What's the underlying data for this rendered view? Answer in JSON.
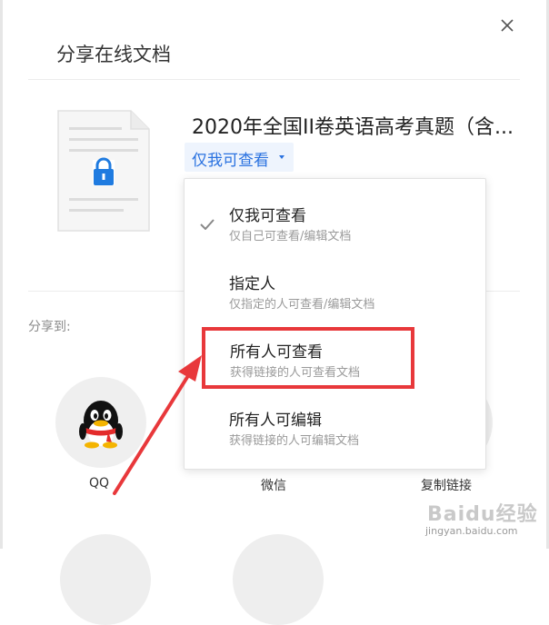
{
  "dialog": {
    "title": "分享在线文档",
    "close_icon": "close-icon"
  },
  "document": {
    "name": "2020年全国II卷英语高考真题（含...",
    "icon": "locked-document-icon",
    "permission_current": "仅我可查看"
  },
  "permission_menu": {
    "options": [
      {
        "label": "仅我可查看",
        "desc": "仅自己可查看/编辑文档",
        "selected": true
      },
      {
        "label": "指定人",
        "desc": "仅指定的人可查看/编辑文档",
        "selected": false
      },
      {
        "label": "所有人可查看",
        "desc": "获得链接的人可查看文档",
        "selected": false
      },
      {
        "label": "所有人可编辑",
        "desc": "获得链接的人可编辑文档",
        "selected": false
      }
    ]
  },
  "share": {
    "label": "分享到:",
    "targets": [
      {
        "label": "QQ",
        "icon": "qq-penguin-icon"
      },
      {
        "label": "微信",
        "icon": "wechat-icon"
      },
      {
        "label": "复制链接",
        "icon": "copy-link-icon"
      }
    ]
  },
  "annotation": {
    "color": "#e8383b"
  },
  "watermark": {
    "brand": "Baidu经验",
    "url": "jingyan.baidu.com"
  },
  "colors": {
    "accent": "#2a72e0",
    "trigger_bg": "#eef4fd",
    "highlight": "#e8383b"
  }
}
